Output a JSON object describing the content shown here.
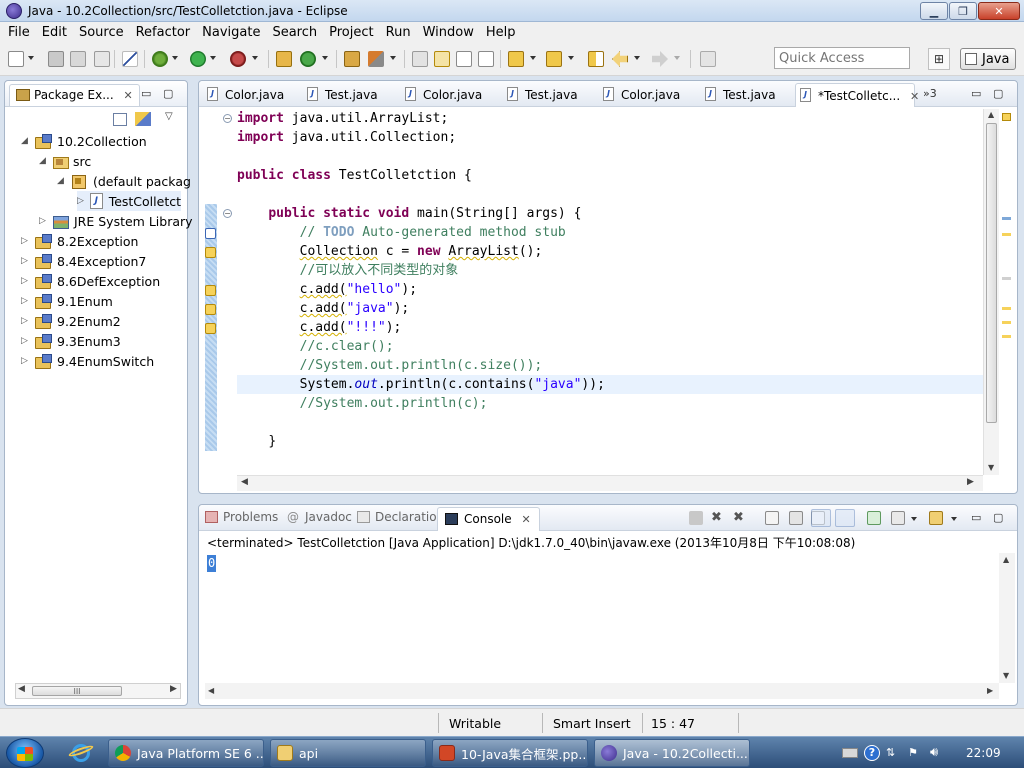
{
  "window": {
    "title": "Java - 10.2Collection/src/TestColletction.java - Eclipse",
    "controls": {
      "minimize": "▁",
      "maximize": "❐",
      "close": "✕"
    }
  },
  "menubar": {
    "items": [
      "File",
      "Edit",
      "Source",
      "Refactor",
      "Navigate",
      "Search",
      "Project",
      "Run",
      "Window",
      "Help"
    ]
  },
  "toolbar": {
    "quick_access_placeholder": "Quick Access",
    "perspective_label": "Java"
  },
  "package_explorer": {
    "tab_label": "Package Ex...",
    "tree": [
      {
        "label": "10.2Collection",
        "type": "project",
        "expanded": true,
        "level": 0
      },
      {
        "label": "src",
        "type": "source-folder",
        "expanded": true,
        "level": 1
      },
      {
        "label": "(default packag",
        "type": "package",
        "expanded": true,
        "level": 2
      },
      {
        "label": "TestColletct",
        "type": "java-file",
        "expanded": false,
        "level": 3
      },
      {
        "label": "JRE System Library",
        "type": "jre",
        "expanded": false,
        "level": 1
      },
      {
        "label": "8.2Exception",
        "type": "project",
        "expanded": false,
        "level": 0
      },
      {
        "label": "8.4Exception7",
        "type": "project",
        "expanded": false,
        "level": 0
      },
      {
        "label": "8.6DefException",
        "type": "project",
        "expanded": false,
        "level": 0
      },
      {
        "label": "9.1Enum",
        "type": "project",
        "expanded": false,
        "level": 0
      },
      {
        "label": "9.2Enum2",
        "type": "project",
        "expanded": false,
        "level": 0
      },
      {
        "label": "9.3Enum3",
        "type": "project",
        "expanded": false,
        "level": 0
      },
      {
        "label": "9.4EnumSwitch",
        "type": "project",
        "expanded": false,
        "level": 0
      }
    ],
    "scroll_thumb_grip": "III"
  },
  "editor": {
    "tabs": [
      {
        "label": "Color.java",
        "active": false
      },
      {
        "label": "Test.java",
        "active": false
      },
      {
        "label": "Color.java",
        "active": false
      },
      {
        "label": "Test.java",
        "active": false
      },
      {
        "label": "Color.java",
        "active": false
      },
      {
        "label": "Test.java",
        "active": false
      },
      {
        "label": "*TestColletc...",
        "active": true
      }
    ],
    "overflow_label": "»3",
    "code": {
      "l1_kw": "import",
      "l1_rest": " java.util.ArrayList;",
      "l2_kw": "import",
      "l2_rest": " java.util.Collection;",
      "l3_kw1": "public",
      "l3_kw2": "class",
      "l3_rest": " TestColletction {",
      "l4_indent": "    ",
      "l4_kw1": "public",
      "l4_kw2": "static",
      "l4_kw3": "void",
      "l4_rest": " main(String[] args) {",
      "l5_indent": "        ",
      "l5_c1": "// ",
      "l5_todo": "TODO",
      "l5_c2": " Auto-generated method stub",
      "l6_indent": "        ",
      "l6_a": "Collection",
      "l6_b": " c = ",
      "l6_kw": "new",
      "l6_c": " ",
      "l6_d": "ArrayList",
      "l6_e": "();",
      "l7_indent": "        ",
      "l7_cmt": "//可以放入不同类型的对象",
      "l8_indent": "        ",
      "l8_a": "c.add(",
      "l8_str": "\"hello\"",
      "l8_b": ");",
      "l9_indent": "        ",
      "l9_a": "c.add(",
      "l9_str": "\"java\"",
      "l9_b": ");",
      "l10_indent": "        ",
      "l10_a": "c.add(",
      "l10_str": "\"!!!\"",
      "l10_b": ");",
      "l11_indent": "        ",
      "l11_cmt": "//c.clear();",
      "l12_indent": "        ",
      "l12_cmt": "//System.out.println(c.size());",
      "l13_indent": "        ",
      "l13_a": "System.",
      "l13_out": "out",
      "l13_b": ".println(c.contains(",
      "l13_str": "\"java\"",
      "l13_c": "));",
      "l14_indent": "        ",
      "l14_cmt": "//System.out.println(c);",
      "l15_indent": "    ",
      "l15_a": "}"
    }
  },
  "console": {
    "tabs": [
      {
        "label": "Problems",
        "active": false
      },
      {
        "label": "Javadoc",
        "active": false
      },
      {
        "label": "Declaration",
        "active": false
      },
      {
        "label": "Console",
        "active": true
      }
    ],
    "status_text": "<terminated> TestColletction [Java Application] D:\\jdk1.7.0_40\\bin\\javaw.exe (2013年10月8日 下午10:08:08)",
    "output": "0"
  },
  "statusbar": {
    "writable": "Writable",
    "insert_mode": "Smart Insert",
    "position": "15 : 47"
  },
  "taskbar": {
    "buttons": [
      {
        "label": "Java Platform SE 6 ..."
      },
      {
        "label": "api"
      },
      {
        "label": "10-Java集合框架.pp..."
      },
      {
        "label": "Java - 10.2Collecti..."
      }
    ],
    "clock": "22:09"
  },
  "colors": {
    "keyword": "#7f0055",
    "string": "#2a00ff",
    "comment": "#3f7f5f",
    "todo": "#7f9fbf",
    "static_field": "#0000c0"
  }
}
